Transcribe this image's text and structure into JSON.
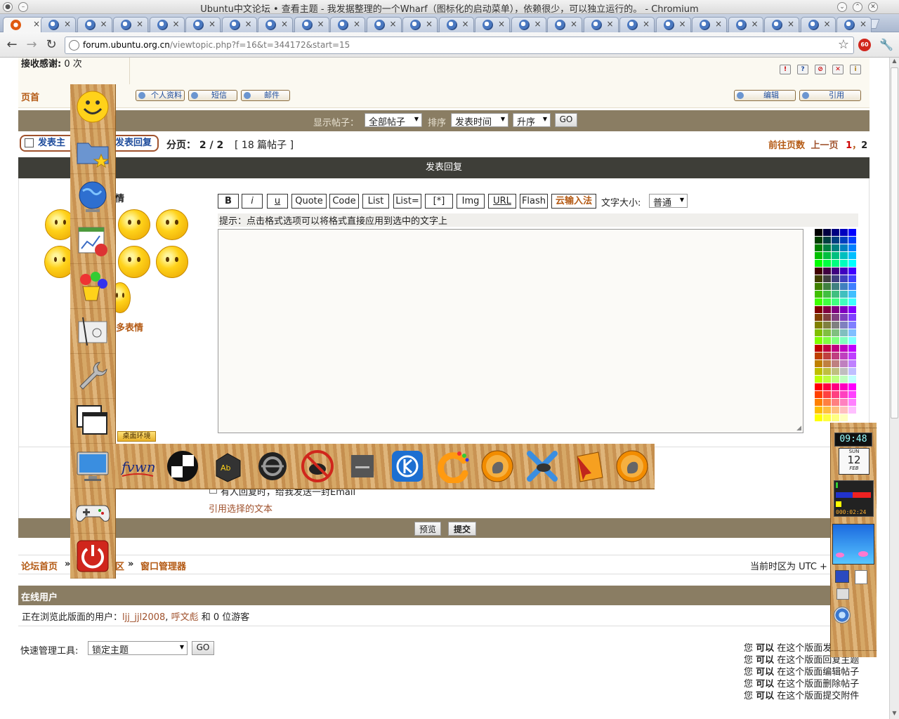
{
  "window": {
    "title": "Ubuntu中文论坛 • 查看主题 - 我发据整理的一个Wharf（图标化的启动菜单），依赖很少，可以独立运行的。 - Chromium"
  },
  "browser": {
    "url_host": "forum.ubuntu.org.cn",
    "url_path": "/viewtopic.php?f=16&t=344172&start=15",
    "tab_count": 24
  },
  "post": {
    "thanks_label": "接收感谢:",
    "thanks_value": "0 次",
    "top_link": "页首",
    "buttons": [
      "个人资料",
      "短信",
      "邮件"
    ],
    "edit_label": "编辑",
    "quote_label": "引用",
    "report_icons": [
      "!",
      "?",
      "⊘",
      "✕",
      "i"
    ]
  },
  "filter": {
    "show_label": "显示帖子：",
    "show_value": "全部帖子",
    "sort_label": "排序",
    "sort_value": "发表时间",
    "order_value": "升序",
    "go": "GO"
  },
  "pagination": {
    "new_topic": "发表主",
    "post_reply": "发表回复",
    "page_info": "分页： 2 / 2",
    "post_count": "[ 18 篇帖子 ]",
    "goto_label": "前往页数",
    "prev": "上一页",
    "page1": "1",
    "sep": "，",
    "page2": "2"
  },
  "reply": {
    "header": "发表回复",
    "smilies_label": "情",
    "more_smilies": "多表情",
    "format_buttons": [
      "B",
      "i",
      "u",
      "Quote",
      "Code",
      "List",
      "List=",
      "[*]",
      "Img",
      "URL",
      "Flash",
      "云输入法"
    ],
    "font_size_label": "文字大小:",
    "font_size_value": "普通",
    "hint": "提示：点击格式选项可以将格式直接应用到选中的文字上",
    "notify_text": "有人回复时，给我发送一封Email",
    "quote_selected": "引用选择的文本",
    "preview": "预览",
    "submit": "提交"
  },
  "breadcrumb": {
    "home": "论坛首页",
    "sep": "»",
    "mid": "区",
    "current": "窗口管理器",
    "timezone": "当前时区为 UTC +"
  },
  "online": {
    "header": "在线用户",
    "prefix": "正在浏览此版面的用户：",
    "user1": "ljj_jjl2008",
    "comma": ",",
    "user2": "呼文彪",
    "suffix": "和 0 位游客"
  },
  "quickmod": {
    "label": "快速管理工具:",
    "value": "锁定主题",
    "go": "GO"
  },
  "permissions": [
    {
      "a": "您",
      "b": "可以",
      "c": "在这个版面发表新主题"
    },
    {
      "a": "您",
      "b": "可以",
      "c": "在这个版面回复主题"
    },
    {
      "a": "您",
      "b": "可以",
      "c": "在这个版面编辑帖子"
    },
    {
      "a": "您",
      "b": "可以",
      "c": "在这个版面删除帖子"
    },
    {
      "a": "您",
      "b": "可以",
      "c": "在这个版面提交附件"
    }
  ],
  "wharf": {
    "tag_label": "桌面环境",
    "clock_time": "09:48",
    "date_day": "SUN",
    "date_num": "12",
    "date_month": "FEB",
    "timer": "000:02:24",
    "vertical_icons": [
      "smiley-icon",
      "folder-star-icon",
      "globe-icon",
      "office-icon",
      "paint-icon",
      "drafting-icon",
      "wrench-icon",
      "windows-icon",
      "monitor-icon",
      "gamepad-icon",
      "power-icon"
    ],
    "horizontal_icons": [
      "fvwm-icon",
      "blackbox-icon",
      "afterstep-icon",
      "openbox-icon",
      "ratpoison-icon",
      "box-icon",
      "kde-icon",
      "enlightenment-icon",
      "gnome-foot-icon",
      "xfce-icon",
      "icewm-icon",
      "gnome-foot-2-icon"
    ]
  },
  "colors": {
    "bar_brown": "#8a7d63",
    "bar_dark": "#3e3e38",
    "link": "#a0522d",
    "accent_orange": "#b45a14"
  }
}
